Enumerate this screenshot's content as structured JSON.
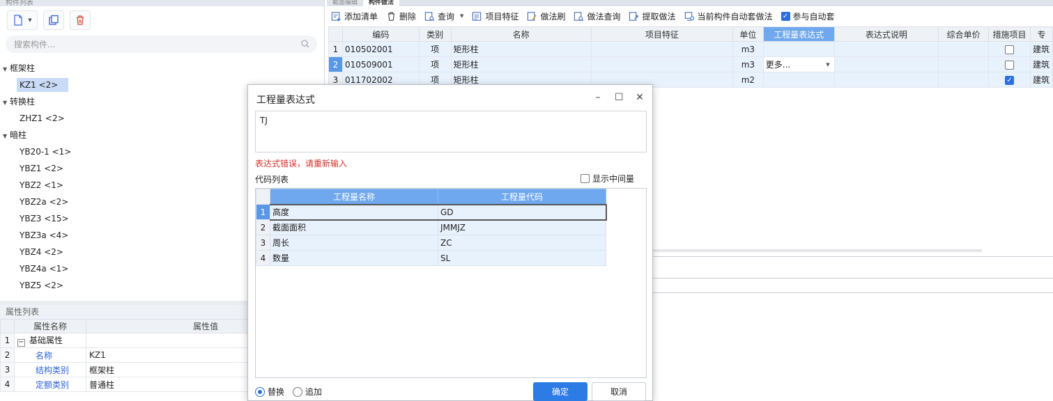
{
  "left": {
    "panel_title": "构件列表",
    "search_placeholder": "搜索构件...",
    "groups": [
      {
        "label": "框架柱",
        "items": [
          "KZ1 <2>"
        ]
      },
      {
        "label": "转换柱",
        "items": [
          "ZHZ1 <2>"
        ]
      },
      {
        "label": "暗柱",
        "items": [
          "YB20-1 <1>",
          "YBZ1 <2>",
          "YBZ2 <1>",
          "YBZ2a <2>",
          "YBZ3 <15>",
          "YBZ3a <4>",
          "YBZ4 <2>",
          "YBZ4a <1>",
          "YBZ5 <2>"
        ]
      }
    ],
    "selected_item": "KZ1 <2>"
  },
  "props": {
    "title": "属性列表",
    "col_name": "属性名称",
    "col_value": "属性值",
    "rows": [
      {
        "num": "1",
        "name": "基础属性",
        "value": "",
        "group": true
      },
      {
        "num": "2",
        "name": "名称",
        "value": "KZ1"
      },
      {
        "num": "3",
        "name": "结构类别",
        "value": "框架柱"
      },
      {
        "num": "4",
        "name": "定额类别",
        "value": "普通柱"
      }
    ]
  },
  "right": {
    "tabs": [
      "截面编辑",
      "构件做法"
    ],
    "toolbar": {
      "add_list": "添加清单",
      "delete": "删除",
      "query": "查询",
      "item_feature": "项目特征",
      "method_brush": "做法刷",
      "method_query": "做法查询",
      "extract_method": "提取做法",
      "auto_apply": "当前构件自动套做法",
      "join_auto": "参与自动套"
    },
    "columns": [
      "编码",
      "类别",
      "名称",
      "项目特征",
      "单位",
      "工程量表达式",
      "表达式说明",
      "综合单价",
      "措施项目",
      "专"
    ],
    "rows": [
      {
        "num": "1",
        "code": "010502001",
        "type": "项",
        "name": "矩形柱",
        "feature": "",
        "unit": "m3",
        "expr": "",
        "desc": "",
        "price": "",
        "measure": false,
        "spec": "建筑"
      },
      {
        "num": "2",
        "code": "010509001",
        "type": "项",
        "name": "矩形柱",
        "feature": "",
        "unit": "m3",
        "expr": "更多...",
        "desc": "",
        "price": "",
        "measure": false,
        "spec": "建筑"
      },
      {
        "num": "3",
        "code": "011702002",
        "type": "项",
        "name": "矩形柱",
        "feature": "",
        "unit": "m2",
        "expr": "",
        "desc": "",
        "price": "",
        "measure": true,
        "spec": "建筑"
      }
    ]
  },
  "dialog": {
    "title": "工程量表达式",
    "expression": "TJ",
    "error": "表达式错误，请重新输入",
    "code_list_label": "代码列表",
    "show_intermediate": "显示中间量",
    "col_name": "工程量名称",
    "col_code": "工程量代码",
    "codes": [
      {
        "num": "1",
        "name": "高度",
        "code": "GD"
      },
      {
        "num": "2",
        "name": "截面面积",
        "code": "JMMJZ"
      },
      {
        "num": "3",
        "name": "周长",
        "code": "ZC"
      },
      {
        "num": "4",
        "name": "数量",
        "code": "SL"
      }
    ],
    "replace": "替换",
    "append": "追加",
    "ok": "确定",
    "cancel": "取消"
  }
}
